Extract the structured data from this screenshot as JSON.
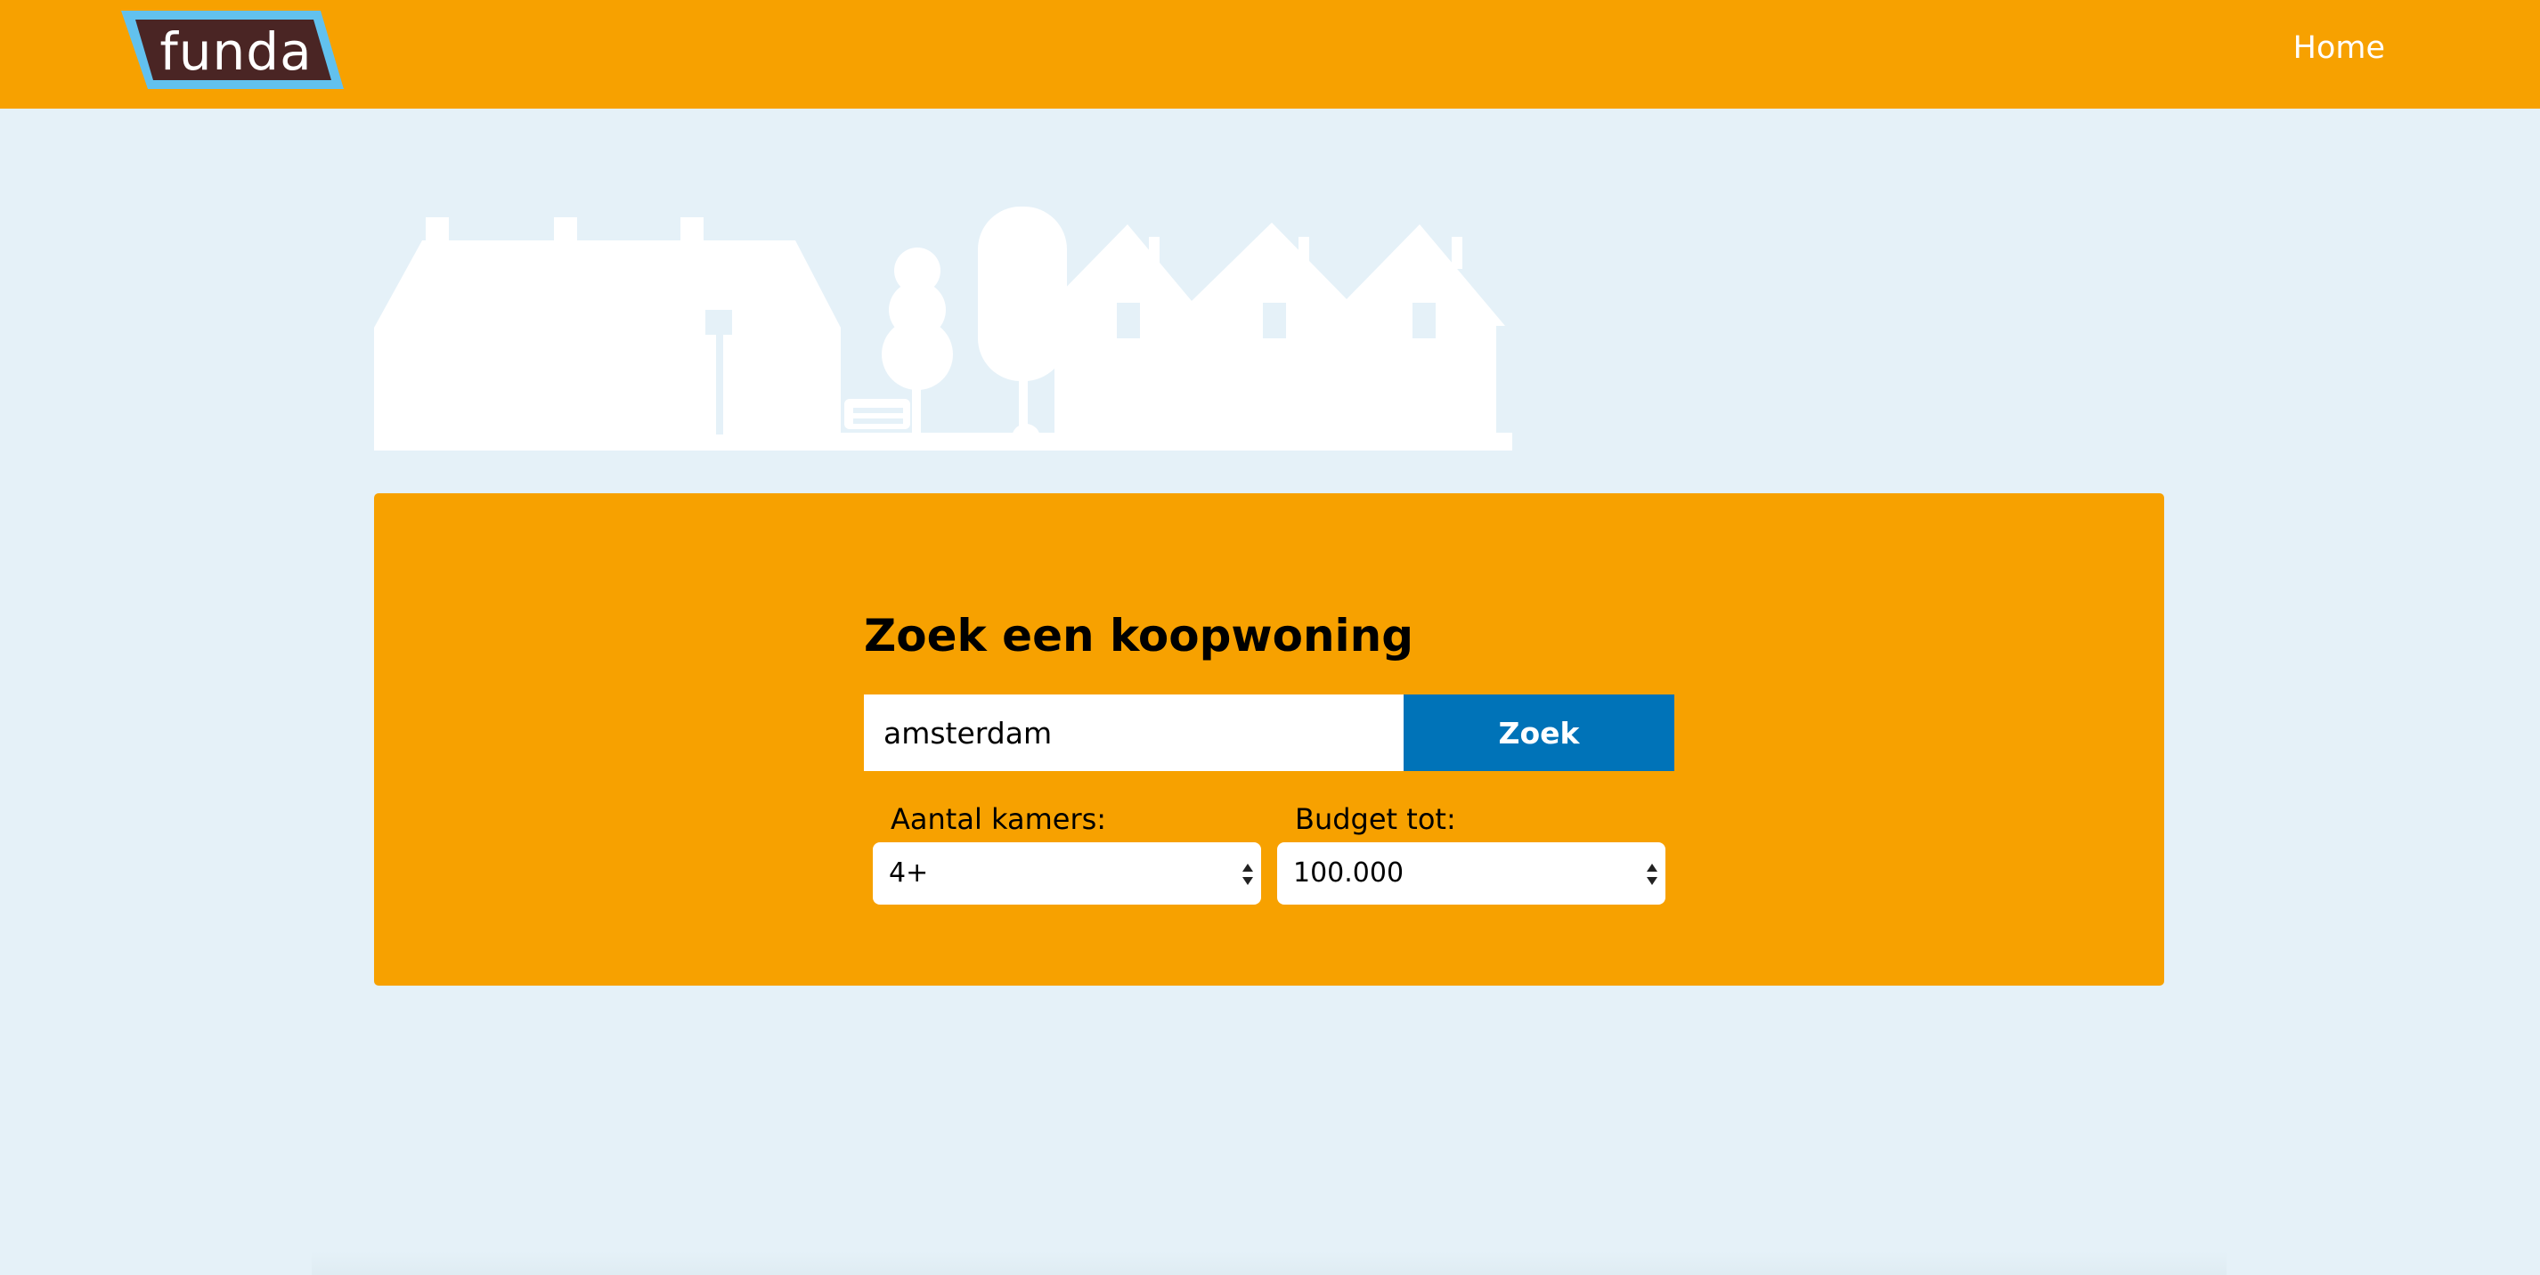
{
  "header": {
    "logo_text": "funda",
    "logo_icon": "funda-logo",
    "nav_home_label": "Home",
    "bar_color": "#f7a100"
  },
  "hero": {
    "illustration": "skyline-illustration"
  },
  "search": {
    "title": "Zoek een koopwoning",
    "input_value": "amsterdam",
    "button_label": "Zoek",
    "button_color": "#0073b8",
    "rooms_label": "Aantal kamers:",
    "rooms_selected": "4+",
    "budget_label": "Budget tot:",
    "budget_selected": "100.000"
  },
  "colors": {
    "page_background": "#e5f1f8",
    "accent": "#f7a100",
    "logo_fill": "#4a2524",
    "logo_border": "#62c1ee"
  }
}
